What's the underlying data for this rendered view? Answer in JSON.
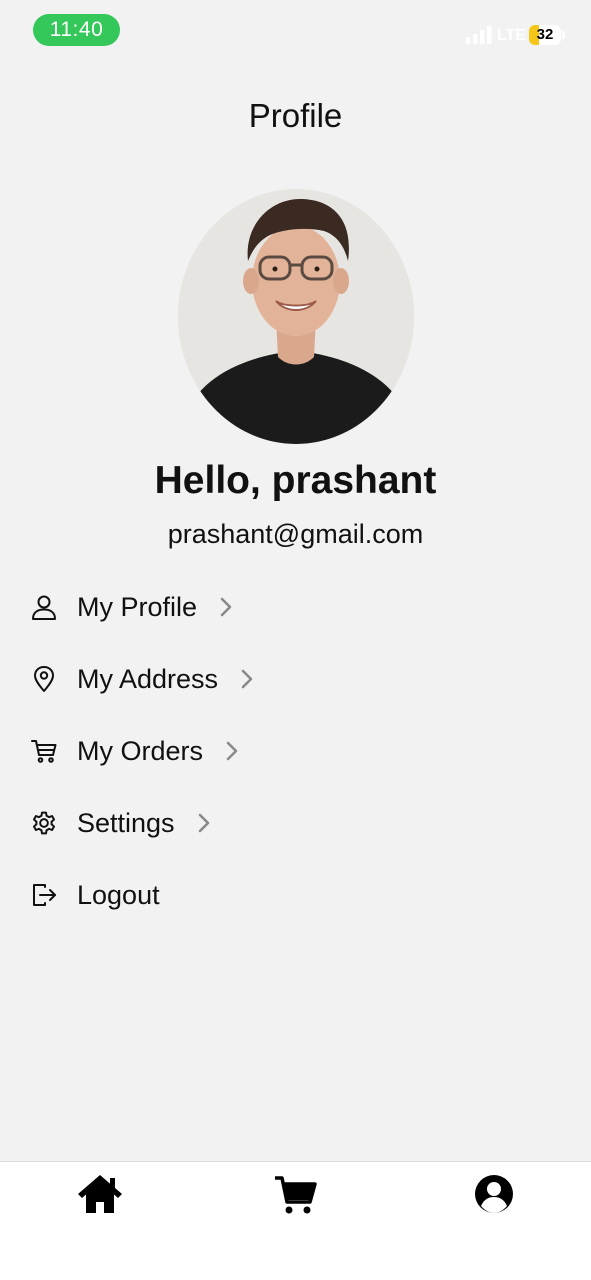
{
  "status_bar": {
    "time": "11:40",
    "network": "LTE",
    "battery_level": "32",
    "battery_fill_percent": 32,
    "colors": {
      "time_pill": "#34c759",
      "battery_fill": "#f5c518"
    }
  },
  "header": {
    "title": "Profile"
  },
  "profile": {
    "greeting": "Hello, prashant",
    "email": "prashant@gmail.com"
  },
  "menu": {
    "items": [
      {
        "label": "My Profile",
        "icon": "user-icon",
        "has_chevron": true
      },
      {
        "label": "My Address",
        "icon": "location-pin-icon",
        "has_chevron": true
      },
      {
        "label": "My Orders",
        "icon": "cart-outline-icon",
        "has_chevron": true
      },
      {
        "label": "Settings",
        "icon": "gear-icon",
        "has_chevron": true
      },
      {
        "label": "Logout",
        "icon": "logout-icon",
        "has_chevron": false
      }
    ]
  },
  "bottom_nav": {
    "items": [
      {
        "icon": "home-icon"
      },
      {
        "icon": "cart-icon"
      },
      {
        "icon": "account-circle-icon",
        "active": true
      }
    ]
  }
}
